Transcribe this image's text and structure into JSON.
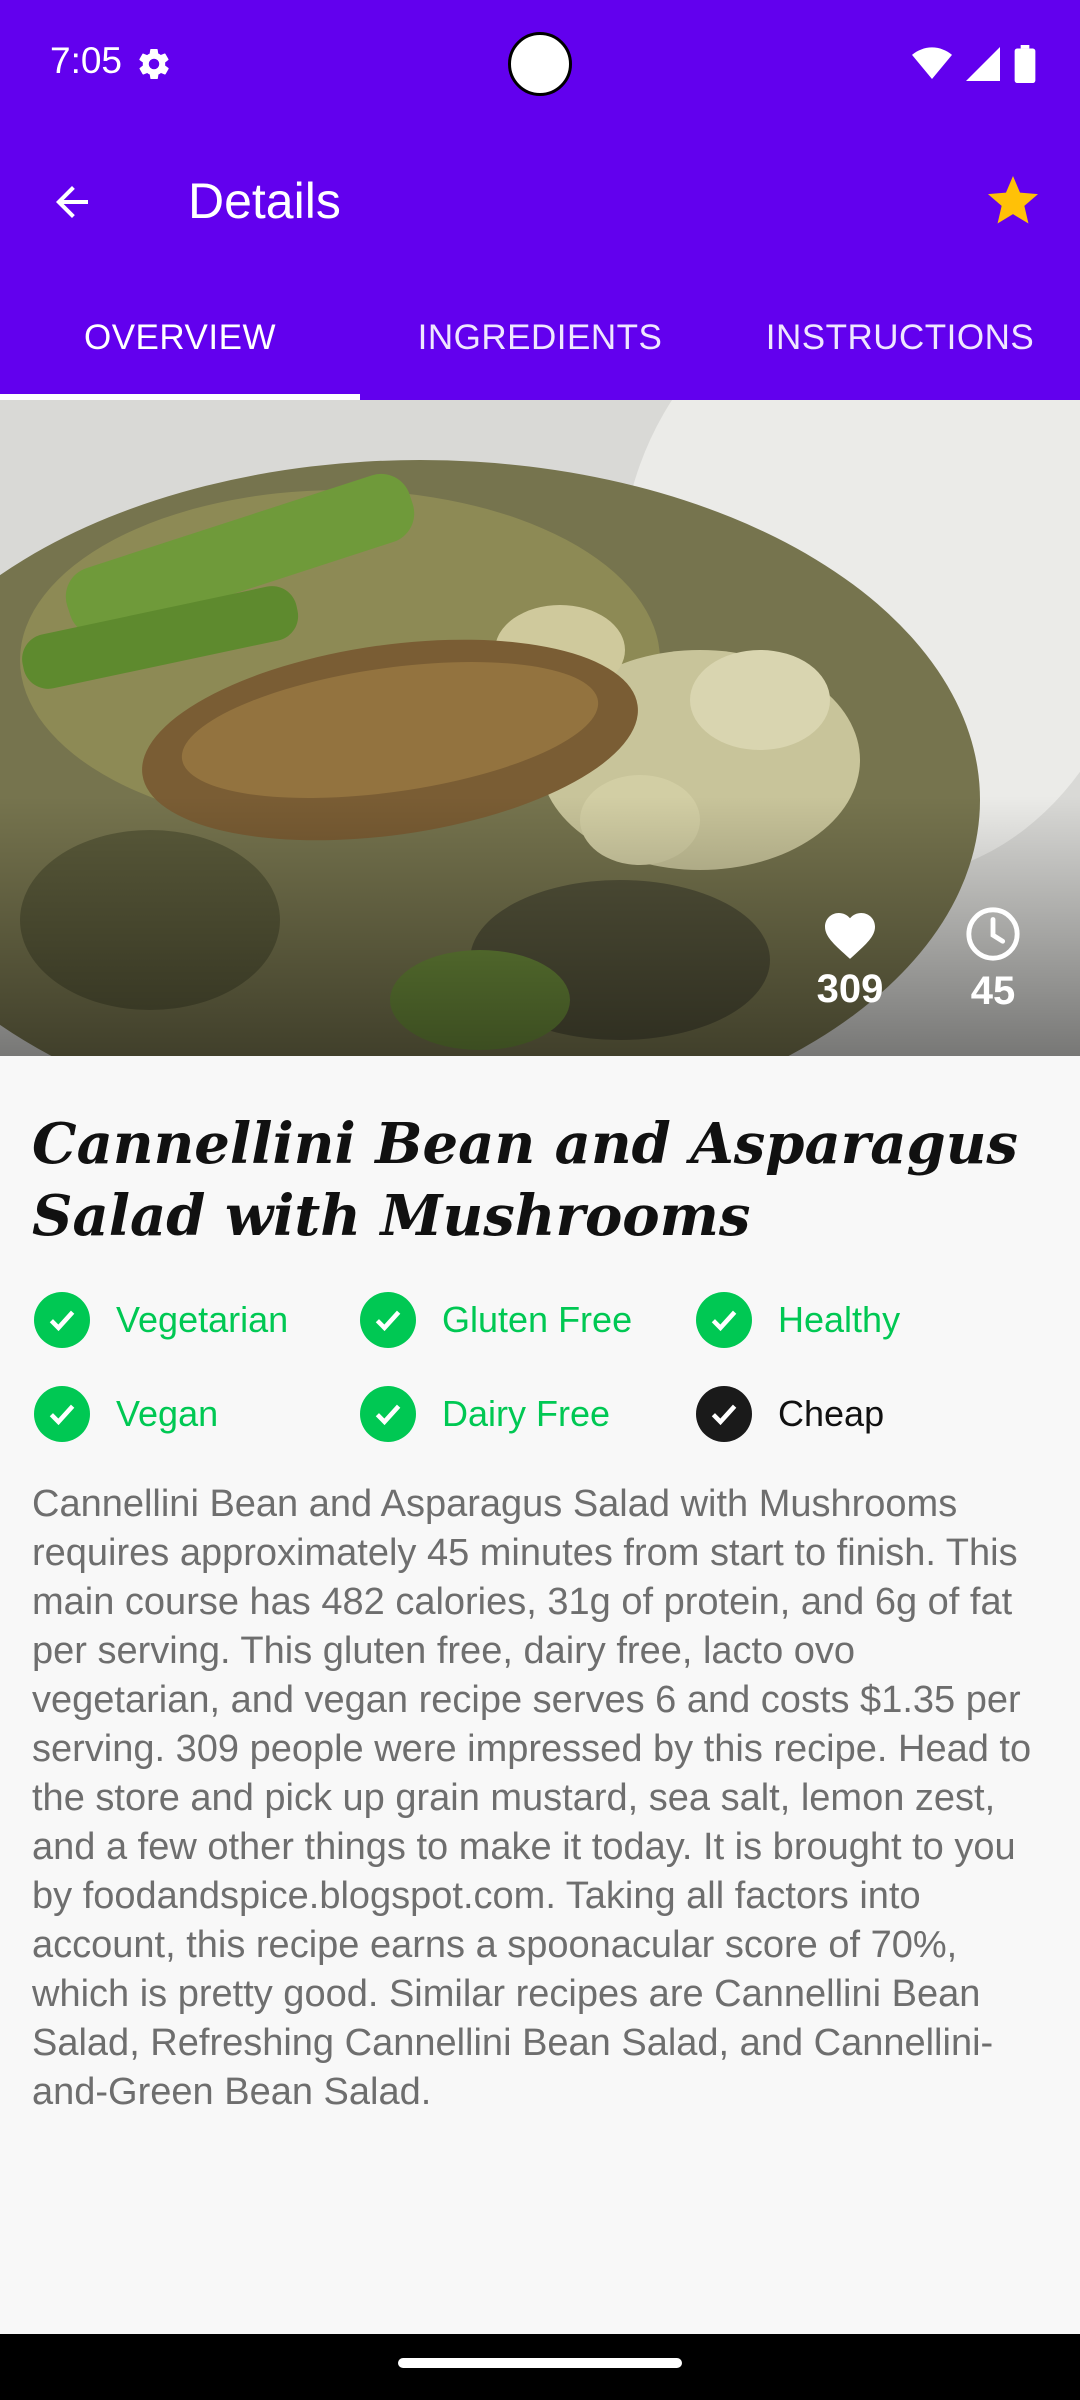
{
  "status_bar": {
    "time": "7:05",
    "icons": [
      "gear-icon",
      "wifi-icon",
      "signal-icon",
      "battery-icon"
    ]
  },
  "app_bar": {
    "title": "Details",
    "back_icon": "arrow-left-icon",
    "favorite_icon": "star-icon",
    "favorite_color": "#ffc107"
  },
  "tabs": [
    {
      "label": "OVERVIEW",
      "selected": true
    },
    {
      "label": "INGREDIENTS",
      "selected": false
    },
    {
      "label": "INSTRUCTIONS",
      "selected": false
    }
  ],
  "hero": {
    "likes": "309",
    "minutes": "45",
    "likes_icon": "heart-icon",
    "time_icon": "clock-icon"
  },
  "recipe": {
    "title": "Cannellini Bean and Asparagus Salad with Mushrooms",
    "badges": [
      {
        "label": "Vegetarian",
        "active": true
      },
      {
        "label": "Gluten Free",
        "active": true
      },
      {
        "label": "Healthy",
        "active": true
      },
      {
        "label": "Vegan",
        "active": true
      },
      {
        "label": "Dairy Free",
        "active": true
      },
      {
        "label": "Cheap",
        "active": false
      }
    ],
    "summary": "Cannellini Bean and Asparagus Salad with Mushrooms requires approximately 45 minutes from start to finish. This main course has 482 calories, 31g of protein, and 6g of fat per serving. This gluten free, dairy free, lacto ovo vegetarian, and vegan recipe serves 6 and costs $1.35 per serving. 309 people were impressed by this recipe. Head to the store and pick up grain mustard, sea salt, lemon zest, and a few other things to make it today. It is brought to you by foodandspice.blogspot.com. Taking all factors into account, this recipe earns a spoonacular score of 70%, which is pretty good. Similar recipes are Cannellini Bean Salad, Refreshing Cannellini Bean Salad, and Cannellini-and-Green Bean Salad."
  },
  "colors": {
    "primary": "#6200ee",
    "active_badge": "#00c853",
    "inactive_badge": "#1a1a1a",
    "star": "#ffc107"
  }
}
